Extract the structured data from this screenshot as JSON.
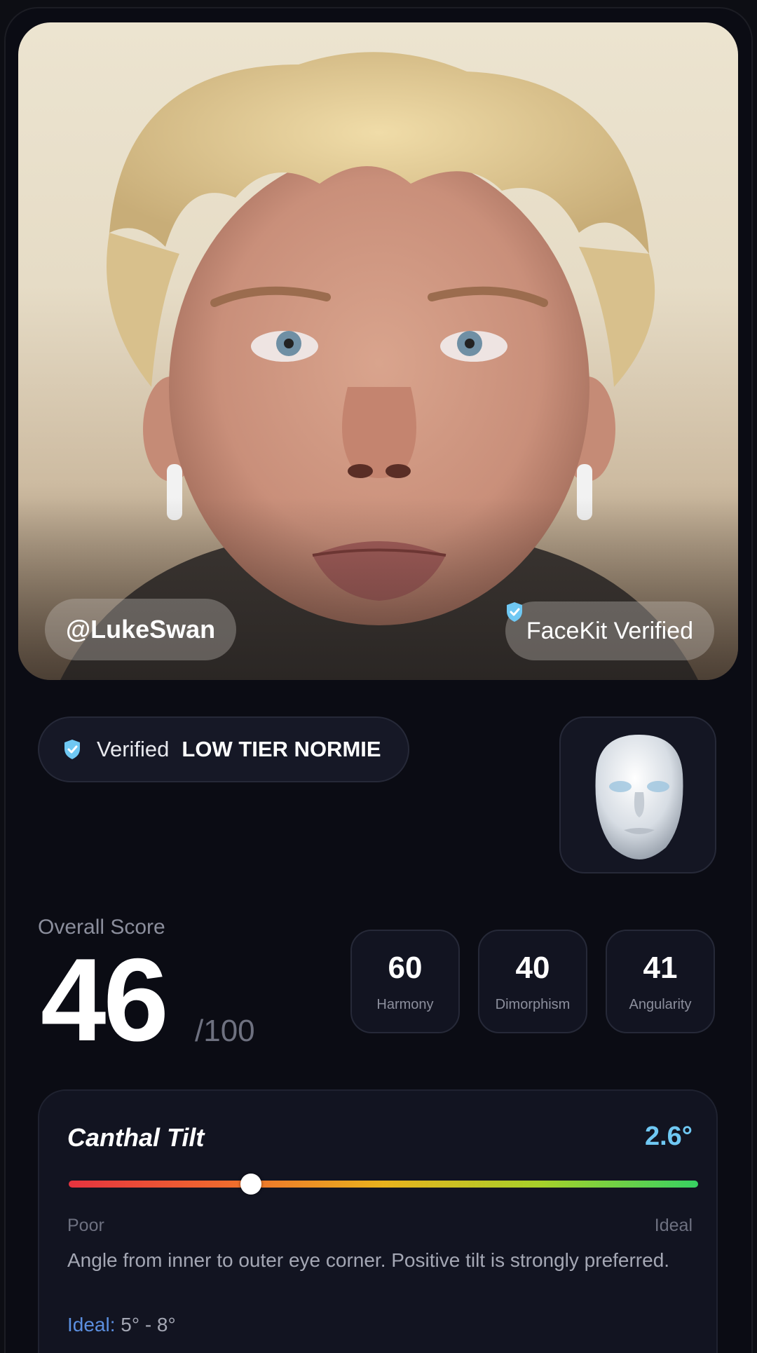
{
  "profile": {
    "username": "@LukeSwan",
    "verified_badge": "FaceKit Verified"
  },
  "tier": {
    "label": "Verified",
    "value": "LOW TIER NORMIE"
  },
  "score": {
    "label": "Overall Score",
    "value": "46",
    "max": "/100"
  },
  "metrics": [
    {
      "value": "60",
      "label": "Harmony"
    },
    {
      "value": "40",
      "label": "Dimorphism"
    },
    {
      "value": "41",
      "label": "Angularity"
    }
  ],
  "canthal": {
    "title": "Canthal Tilt",
    "value": "2.6°",
    "scale_position": 0.29,
    "low_label": "Poor",
    "high_label": "Ideal",
    "description": "Angle from inner to outer eye corner. Positive tilt is strongly preferred.",
    "ideal_key": "Ideal:",
    "ideal_value": "5° - 8°"
  },
  "icons": {
    "badge": "verified-shield-icon",
    "mask": "face-mask-icon"
  },
  "colors": {
    "accent_blue": "#6fc8f3",
    "background": "#0b0c14"
  }
}
